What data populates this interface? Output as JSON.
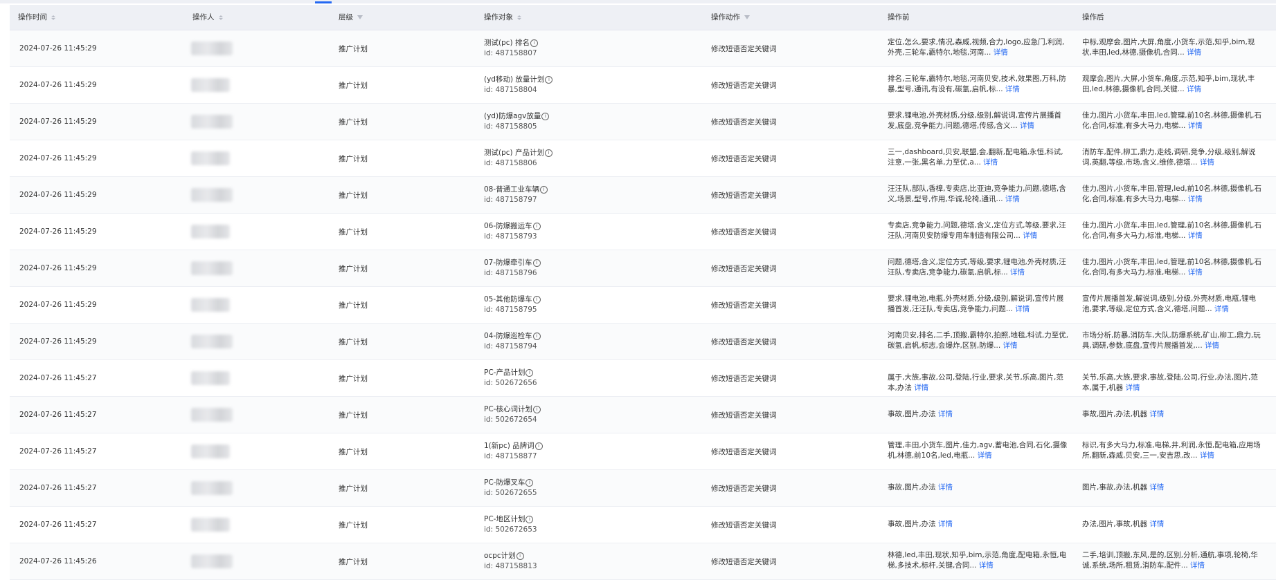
{
  "header": {
    "columns": [
      {
        "label": "操作时间",
        "icon": "sort-icon"
      },
      {
        "label": "操作人",
        "icon": "sort-icon"
      },
      {
        "label": "层级",
        "icon": "filter-icon"
      },
      {
        "label": "操作对象",
        "icon": "sort-icon"
      },
      {
        "label": "操作动作",
        "icon": "filter-icon"
      },
      {
        "label": "操作前",
        "icon": ""
      },
      {
        "label": "操作后",
        "icon": ""
      }
    ]
  },
  "colors": {
    "accent": "#2468f2",
    "header_bg": "#eef0f5"
  },
  "rows": [
    {
      "time": "2024-07-26 11:45:29",
      "level": "推广计划",
      "obj_name": "测试(pc) 排名",
      "obj_id": "id: 487158807",
      "action": "修改短语否定关键词",
      "before": "定位,怎么,要求,情况,森威,视频,合力,logo,应急门,利润,外壳,三轮车,霸特尔,地毯,河南...",
      "after": "中标,观摩会,图片,大屏,角度,小货车,示范,知乎,bim,现状,丰田,led,林德,摄像机,合同..."
    },
    {
      "time": "2024-07-26 11:45:29",
      "level": "推广计划",
      "obj_name": "(yd移动) 放量计划",
      "obj_id": "id: 487158804",
      "action": "修改短语否定关键词",
      "before": "排名,三轮车,霸特尔,地毯,河南贝安,技术,效果图,万科,防暴,型号,通讯,有没有,碳氢,启帆,标...",
      "after": "观摩会,图片,大屏,小货车,角度,示范,知乎,bim,现状,丰田,led,林德,摄像机,合同,关键..."
    },
    {
      "time": "2024-07-26 11:45:29",
      "level": "推广计划",
      "obj_name": "(yd)防爆agv放量",
      "obj_id": "id: 487158805",
      "action": "修改短语否定关键词",
      "before": "要求,锂电池,外壳材质,分级,级别,解说词,宣传片展播首发,底盘,竞争能力,问题,德塔,传感,含义...",
      "after": "佳力,图片,小货车,丰田,led,管理,前10名,林德,摄像机,石化,合同,标准,有多大马力,电梯..."
    },
    {
      "time": "2024-07-26 11:45:29",
      "level": "推广计划",
      "obj_name": "测试(pc) 产品计划",
      "obj_id": "id: 487158806",
      "action": "修改短语否定关键词",
      "before": "三一,dashboard,贝安,联盟,会,翻新,配电箱,永恒,科试,注意,一张,黑名单,力至优,a...",
      "after": "消防车,配件,柳工,鼎力,走线,调研,竞争,分级,级别,解说词,英翻,等级,市场,含义,维修,德塔..."
    },
    {
      "time": "2024-07-26 11:45:29",
      "level": "推广计划",
      "obj_name": "08-普通工业车辆",
      "obj_id": "id: 487158797",
      "action": "修改短语否定关键词",
      "before": "汪汪队,部队,香樟,专卖店,比亚迪,竞争能力,问题,德塔,含义,场景,型号,作用,华诚,轮椅,通讯...",
      "after": "佳力,图片,小货车,丰田,管理,led,前10名,林德,摄像机,石化,合同,标准,有多大马力,电梯..."
    },
    {
      "time": "2024-07-26 11:45:29",
      "level": "推广计划",
      "obj_name": "06-防爆搬运车",
      "obj_id": "id: 487158793",
      "action": "修改短语否定关键词",
      "before": "专卖店,竞争能力,问题,德塔,含义,定位方式,等级,要求,汪汪队,河南贝安防爆专用车制造有限公司...",
      "after": "佳力,图片,小货车,丰田,led,管理,前10名,林德,摄像机,石化,合同,有多大马力,标准,电梯..."
    },
    {
      "time": "2024-07-26 11:45:29",
      "level": "推广计划",
      "obj_name": "07-防爆牵引车",
      "obj_id": "id: 487158796",
      "action": "修改短语否定关键词",
      "before": "问题,德塔,含义,定位方式,等级,要求,锂电池,外壳材质,汪汪队,专卖店,竞争能力,碳氢,启帆,标...",
      "after": "佳力,图片,小货车,丰田,led,管理,前10名,林德,摄像机,石化,合同,有多大马力,标准,电梯..."
    },
    {
      "time": "2024-07-26 11:45:29",
      "level": "推广计划",
      "obj_name": "05-其他防爆车",
      "obj_id": "id: 487158795",
      "action": "修改短语否定关键词",
      "before": "要求,锂电池,电瓶,外壳材质,分级,级别,解说词,宣传片展播首发,汪汪队,专卖店,竞争能力,问题...",
      "after": "宣传片展播首发,解说词,级别,分级,外壳材质,电瓶,锂电池,要求,等级,定位方式,含义,德塔,问题..."
    },
    {
      "time": "2024-07-26 11:45:29",
      "level": "推广计划",
      "obj_name": "04-防爆巡检车",
      "obj_id": "id: 487158794",
      "action": "修改短语否定关键词",
      "before": "河南贝安,排名,二手,顶搬,霸特尔,拍照,地毯,科试,力至优,碳氢,启帆,标志,会爆炸,区别,防爆...",
      "after": "市场分析,防暴,消防车,大队,防爆系统,矿山,柳工,鼎力,玩具,调研,参数,底盘,宣传片展播首发,..."
    },
    {
      "time": "2024-07-26 11:45:27",
      "level": "推广计划",
      "obj_name": "PC-产品计划",
      "obj_id": "id: 502672656",
      "action": "修改短语否定关键词",
      "before": "属于,大族,事故,公司,登陆,行业,要求,关节,乐高,图片,范本,办法",
      "after": "关节,乐高,大族,要求,事故,登陆,公司,行业,办法,图片,范本,属于,机器"
    },
    {
      "time": "2024-07-26 11:45:27",
      "level": "推广计划",
      "obj_name": "PC-核心词计划",
      "obj_id": "id: 502672654",
      "action": "修改短语否定关键词",
      "before": "事故,图片,办法",
      "after": "事故,图片,办法,机器"
    },
    {
      "time": "2024-07-26 11:45:27",
      "level": "推广计划",
      "obj_name": "1(新pc) 品牌词",
      "obj_id": "id: 487158877",
      "action": "修改短语否定关键词",
      "before": "管理,丰田,小货车,图片,佳力,agv,蓄电池,合同,石化,摄像机,林德,前10名,led,电瓶...",
      "after": "标识,有多大马力,标准,电梯,井,利润,永恒,配电箱,应用场所,翻新,森威,贝安,三一,安吉思,改..."
    },
    {
      "time": "2024-07-26 11:45:27",
      "level": "推广计划",
      "obj_name": "PC-防爆叉车",
      "obj_id": "id: 502672655",
      "action": "修改短语否定关键词",
      "before": "事故,图片,办法",
      "after": "图片,事故,办法,机器"
    },
    {
      "time": "2024-07-26 11:45:27",
      "level": "推广计划",
      "obj_name": "PC-地区计划",
      "obj_id": "id: 502672653",
      "action": "修改短语否定关键词",
      "before": "事故,图片,办法",
      "after": "办法,图片,事故,机器"
    },
    {
      "time": "2024-07-26 11:45:26",
      "level": "推广计划",
      "obj_name": "ocpc计划",
      "obj_id": "id: 487158813",
      "action": "修改短语否定关键词",
      "before": "林德,led,丰田,现状,知乎,bim,示范,角度,配电箱,永恒,电梯,多技术,标杆,关键,合同...",
      "after": "二手,培训,顶搬,东风,是的,区别,分析,通航,事项,轮椅,华诚,系统,场所,租赁,消防车,配件..."
    }
  ],
  "detail_label": "详情",
  "info_glyph": "i"
}
